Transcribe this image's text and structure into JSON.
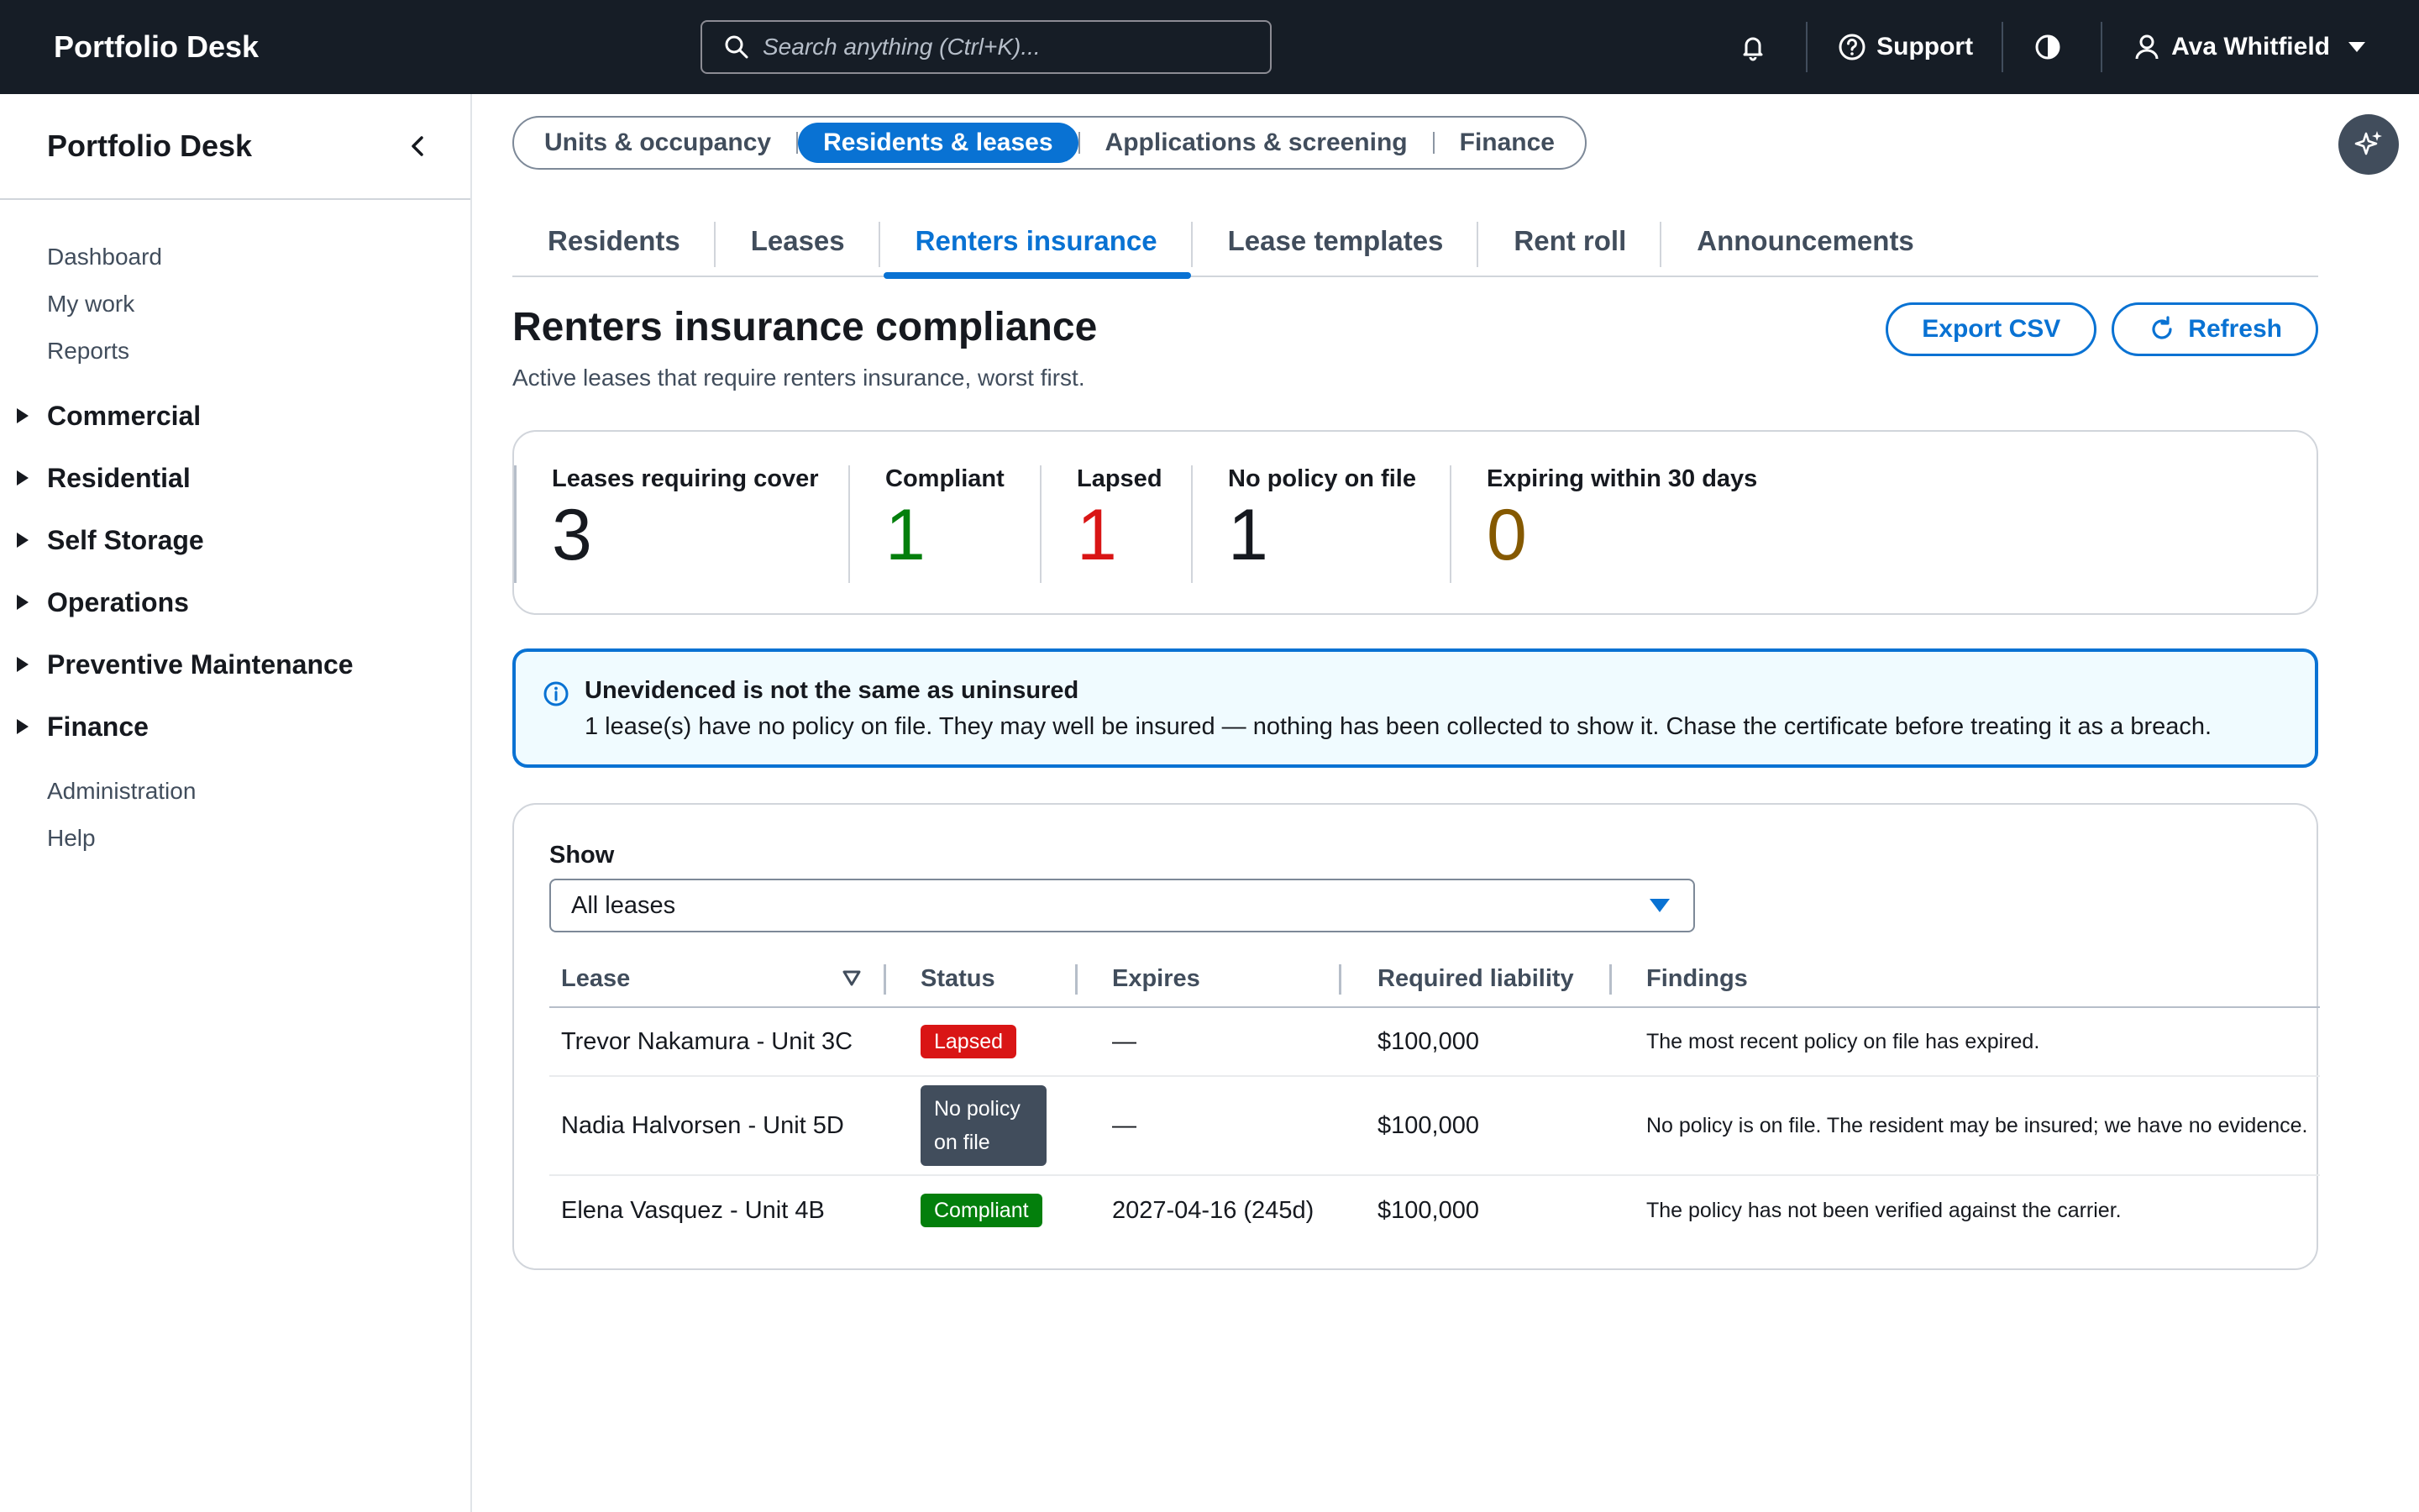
{
  "header": {
    "app_title": "Portfolio Desk",
    "search_placeholder": "Search anything (Ctrl+K)...",
    "support_label": "Support",
    "user_name": "Ava Whitfield"
  },
  "sidebar": {
    "title": "Portfolio Desk",
    "top_links": [
      "Dashboard",
      "My work",
      "Reports"
    ],
    "sections": [
      "Commercial",
      "Residential",
      "Self Storage",
      "Operations",
      "Preventive Maintenance",
      "Finance"
    ],
    "bottom_links": [
      "Administration",
      "Help"
    ]
  },
  "segments": {
    "items": [
      "Units & occupancy",
      "Residents & leases",
      "Applications & screening",
      "Finance"
    ],
    "active": "Residents & leases"
  },
  "tabs": {
    "items": [
      "Residents",
      "Leases",
      "Renters insurance",
      "Lease templates",
      "Rent roll",
      "Announcements"
    ],
    "active": "Renters insurance"
  },
  "page": {
    "title": "Renters insurance compliance",
    "subtitle": "Active leases that require renters insurance, worst first.",
    "export_label": "Export CSV",
    "refresh_label": "Refresh"
  },
  "kpis": [
    {
      "label": "Leases requiring cover",
      "value": "3",
      "color": "#16191f"
    },
    {
      "label": "Compliant",
      "value": "1",
      "color": "#037f0c"
    },
    {
      "label": "Lapsed",
      "value": "1",
      "color": "#d91515"
    },
    {
      "label": "No policy on file",
      "value": "1",
      "color": "#16191f"
    },
    {
      "label": "Expiring within 30 days",
      "value": "0",
      "color": "#855900"
    }
  ],
  "alert": {
    "title": "Unevidenced is not the same as uninsured",
    "body": "1 lease(s) have no policy on file. They may well be insured — nothing has been collected to show it. Chase the certificate before treating it as a breach."
  },
  "filter": {
    "label": "Show",
    "value": "All leases"
  },
  "table": {
    "columns": [
      "Lease",
      "Status",
      "Expires",
      "Required liability",
      "Findings"
    ],
    "rows": [
      {
        "lease": "Trevor Nakamura - Unit 3C",
        "status": "Lapsed",
        "status_kind": "lapsed",
        "expires": "—",
        "liability": "$100,000",
        "findings": "The most recent policy on file has expired."
      },
      {
        "lease": "Nadia Halvorsen - Unit 5D",
        "status": "No policy on file",
        "status_kind": "nopol",
        "expires": "—",
        "liability": "$100,000",
        "findings": "No policy is on file. The resident may be insured; we have no evidence."
      },
      {
        "lease": "Elena Vasquez - Unit 4B",
        "status": "Compliant",
        "status_kind": "ok",
        "expires": "2027-04-16 (245d)",
        "liability": "$100,000",
        "findings": "The policy has not been verified against the carrier."
      }
    ]
  }
}
